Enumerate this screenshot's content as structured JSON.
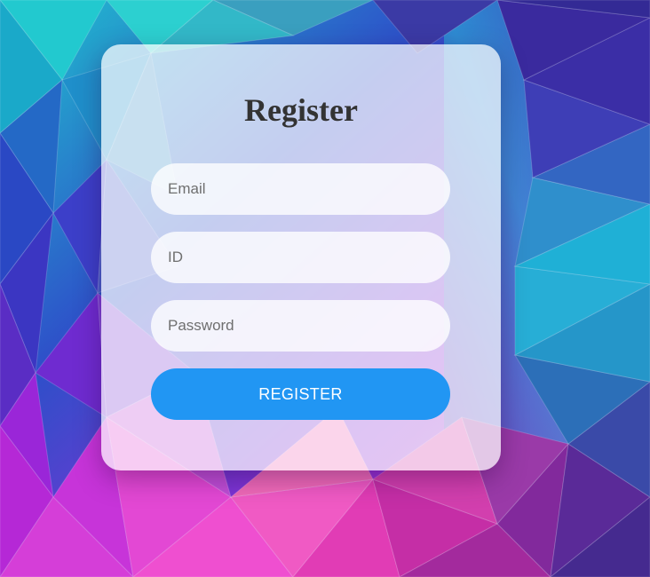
{
  "form": {
    "title": "Register",
    "email_placeholder": "Email",
    "id_placeholder": "ID",
    "password_placeholder": "Password",
    "submit_label": "REGISTER"
  },
  "colors": {
    "accent": "#2196f3",
    "title_text": "#333333",
    "card_background": "rgba(255,255,255,0.72)"
  }
}
